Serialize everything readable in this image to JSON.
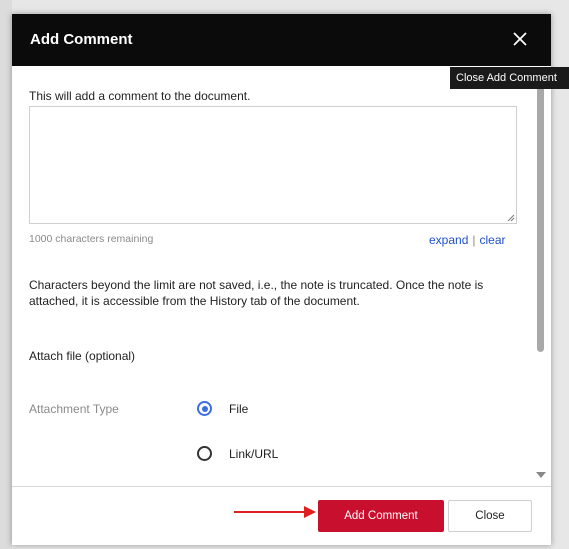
{
  "dialog": {
    "title": "Add Comment",
    "close_tooltip": "Close Add Comment",
    "intro": "This will add a comment to the document.",
    "comment_value": "",
    "characters_remaining": "1000 characters remaining",
    "expand_label": "expand",
    "separator": "|",
    "clear_label": "clear",
    "note": "Characters beyond the limit are not saved, i.e., the note is truncated. Once the note is attached, it is accessible from the History tab of the document.",
    "attach_heading": "Attach file (optional)",
    "attachment_type_label": "Attachment Type",
    "attachment_options": [
      {
        "label": "File",
        "selected": true
      },
      {
        "label": "Link/URL",
        "selected": false
      }
    ]
  },
  "footer": {
    "add_comment_label": "Add Comment",
    "close_label": "Close"
  },
  "colors": {
    "header_bg": "#0b0b0b",
    "primary_button": "#c8102e",
    "link": "#1f4fc9",
    "radio_accent": "#3b6fe0",
    "annotation_arrow": "#e02020"
  },
  "icons": {
    "close": "close-icon",
    "arrow": "annotation-arrow-icon"
  }
}
